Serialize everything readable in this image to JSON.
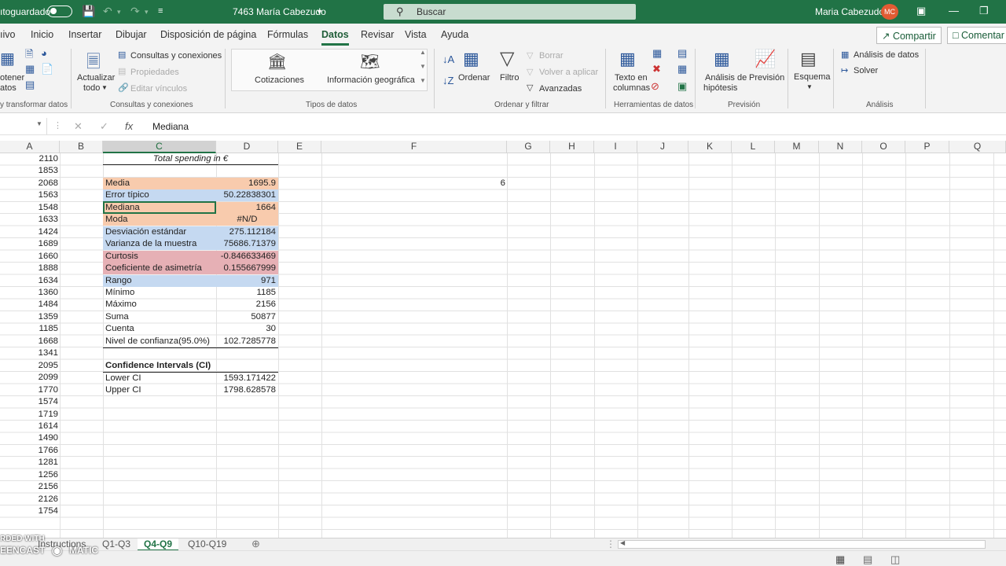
{
  "titlebar": {
    "autosave_label": "ıtoguardado",
    "doc_title": "7463 María Cabezudo",
    "search_placeholder": "Buscar",
    "user_name": "Maria Cabezudo",
    "user_initials": "MC",
    "colors": {
      "accent": "#217346"
    }
  },
  "menu": {
    "items": [
      "ıivo",
      "Inicio",
      "Insertar",
      "Dibujar",
      "Disposición de página",
      "Fórmulas",
      "Datos",
      "Revisar",
      "Vista",
      "Ayuda"
    ],
    "active": "Datos",
    "share": "Compartir",
    "comments": "Comentar"
  },
  "ribbon": {
    "get_data": {
      "l1": "otener",
      "l2": "atos",
      "group": "y transformar datos"
    },
    "queries": {
      "refresh_l1": "Actualizar",
      "refresh_l2": "todo",
      "item1": "Consultas y conexiones",
      "item2": "Propiedades",
      "item3": "Editar vínculos",
      "group": "Consultas y conexiones"
    },
    "types": {
      "item1": "Cotizaciones",
      "item2": "Información geográfica",
      "group": "Tipos de datos"
    },
    "sort": {
      "sort": "Ordenar",
      "filter": "Filtro",
      "clear": "Borrar",
      "reapply": "Volver a aplicar",
      "advanced": "Avanzadas",
      "group": "Ordenar y filtrar"
    },
    "tools": {
      "l1": "Texto en",
      "l2": "columnas",
      "group": "Herramientas de datos"
    },
    "forecast": {
      "whatif_l1": "Análisis de",
      "whatif_l2": "hipótesis",
      "forecast": "Previsión",
      "group": "Previsión"
    },
    "outline": {
      "label": "Esquema"
    },
    "analysis": {
      "item1": "Análisis de datos",
      "item2": "Solver",
      "group": "Análisis"
    }
  },
  "formula": {
    "value": "Mediana"
  },
  "columns": [
    "A",
    "B",
    "C",
    "D",
    "E",
    "F",
    "G",
    "H",
    "I",
    "J",
    "K",
    "L",
    "M",
    "N",
    "O",
    "P",
    "Q"
  ],
  "colA": [
    "2110",
    "1853",
    "2068",
    "1563",
    "1548",
    "1633",
    "1424",
    "1689",
    "1660",
    "1888",
    "1634",
    "1360",
    "1484",
    "1359",
    "1185",
    "1668",
    "1341",
    "2095",
    "2099",
    "1770",
    "1574",
    "1719",
    "1614",
    "1490",
    "1766",
    "1281",
    "1256",
    "2156",
    "2126",
    "1754"
  ],
  "stats_title": "Total spending in €",
  "stats": [
    {
      "label": "Media",
      "value": "1695.9"
    },
    {
      "label": "Error típico",
      "value": "50.22838301"
    },
    {
      "label": "Mediana",
      "value": "1664"
    },
    {
      "label": "Moda",
      "value": "#N/D"
    },
    {
      "label": "Desviación estándar",
      "value": "275.112184"
    },
    {
      "label": "Varianza de la muestra",
      "value": "75686.71379"
    },
    {
      "label": "Curtosis",
      "value": "-0.846633469"
    },
    {
      "label": "Coeficiente de asimetría",
      "value": "0.155667999"
    },
    {
      "label": "Rango",
      "value": "971"
    },
    {
      "label": "Mínimo",
      "value": "1185"
    },
    {
      "label": "Máximo",
      "value": "2156"
    },
    {
      "label": "Suma",
      "value": "50877"
    },
    {
      "label": "Cuenta",
      "value": "30"
    },
    {
      "label": "Nivel de confianza(95.0%)",
      "value": "102.7285778"
    }
  ],
  "f_cell": "6",
  "ci": {
    "title": "Confidence Intervals (CI)",
    "lower_label": "Lower CI",
    "lower": "1593.171422",
    "upper_label": "Upper CI",
    "upper": "1798.628578"
  },
  "tabs": [
    "Instructions",
    "Q1-Q3",
    "Q4-Q9",
    "Q10-Q19"
  ],
  "active_tab": "Q4-Q9",
  "watermark": {
    "l1": "RDED WITH",
    "l2": "EENCAST",
    "l3": "MATIC"
  },
  "colors": {
    "peach": "#f8cbad",
    "blue": "#c5d9f1",
    "red": "#e6b0b5"
  }
}
